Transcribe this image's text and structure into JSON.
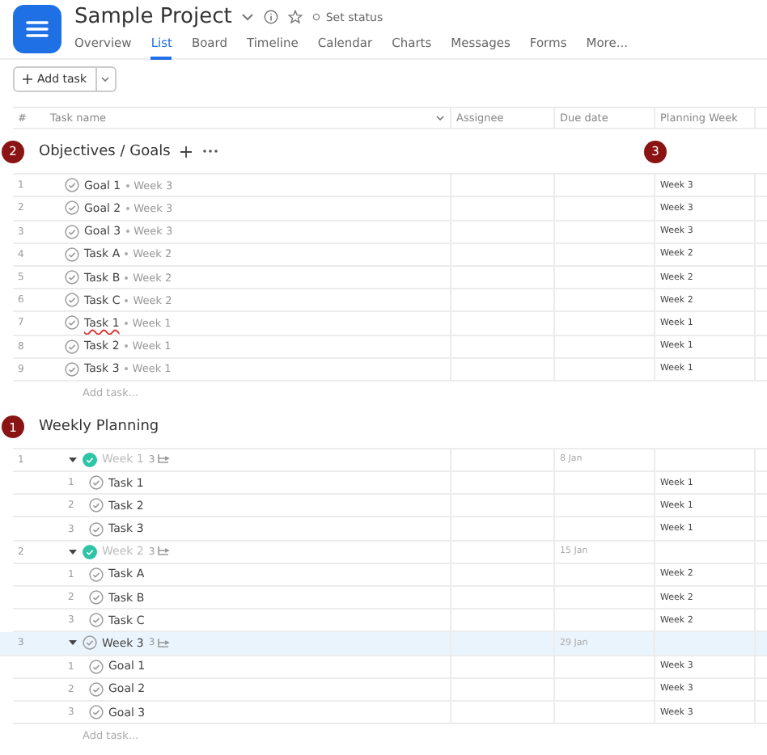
{
  "project": {
    "title": "Sample Project",
    "status": "Set status"
  },
  "tabs": [
    {
      "label": "Overview",
      "selected": false
    },
    {
      "label": "List",
      "selected": true
    },
    {
      "label": "Board",
      "selected": false
    },
    {
      "label": "Timeline",
      "selected": false
    },
    {
      "label": "Calendar",
      "selected": false
    },
    {
      "label": "Charts",
      "selected": false
    },
    {
      "label": "Messages",
      "selected": false
    },
    {
      "label": "Forms",
      "selected": false
    },
    {
      "label": "More...",
      "selected": false
    }
  ],
  "toolbar": {
    "add_task": "Add task"
  },
  "columns": [
    "#",
    "Task name",
    "Assignee",
    "Due date",
    "Planning Week"
  ],
  "sections": [
    {
      "title": "Objectives / Goals",
      "marker": "2",
      "column_marker": "3",
      "add_task": "Add task...",
      "tasks": [
        {
          "number": "1",
          "name": "Goal 1",
          "parent": "Week 3",
          "planning_week": "Week 3",
          "misspelled": false
        },
        {
          "number": "2",
          "name": "Goal 2",
          "parent": "Week 3",
          "planning_week": "Week 3",
          "misspelled": false
        },
        {
          "number": "3",
          "name": "Goal 3",
          "parent": "Week 3",
          "planning_week": "Week 3",
          "misspelled": false
        },
        {
          "number": "4",
          "name": "Task A",
          "parent": "Week 2",
          "planning_week": "Week 2",
          "misspelled": false
        },
        {
          "number": "5",
          "name": "Task B",
          "parent": "Week 2",
          "planning_week": "Week 2",
          "misspelled": false
        },
        {
          "number": "6",
          "name": "Task C",
          "parent": "Week 2",
          "planning_week": "Week 2",
          "misspelled": false
        },
        {
          "number": "7",
          "name": "Task 1",
          "parent": "Week 1",
          "planning_week": "Week 1",
          "misspelled": true
        },
        {
          "number": "8",
          "name": "Task 2",
          "parent": "Week 1",
          "planning_week": "Week 1",
          "misspelled": false
        },
        {
          "number": "9",
          "name": "Task 3",
          "parent": "Week 1",
          "planning_week": "Week 1",
          "misspelled": false
        }
      ]
    },
    {
      "title": "Weekly Planning",
      "marker": "1",
      "add_task": "Add task...",
      "tasks": [
        {
          "number": "1",
          "name": "Week 1",
          "completed": true,
          "expanded": true,
          "selected": false,
          "subtask_count": "3",
          "due_date": "8 Jan",
          "children": [
            {
              "number": "1",
              "name": "Task 1",
              "planning_week": "Week 1"
            },
            {
              "number": "2",
              "name": "Task 2",
              "planning_week": "Week 1"
            },
            {
              "number": "3",
              "name": "Task 3",
              "planning_week": "Week 1"
            }
          ]
        },
        {
          "number": "2",
          "name": "Week 2",
          "completed": true,
          "expanded": true,
          "selected": false,
          "subtask_count": "3",
          "due_date": "15 Jan",
          "children": [
            {
              "number": "1",
              "name": "Task A",
              "planning_week": "Week 2"
            },
            {
              "number": "2",
              "name": "Task B",
              "planning_week": "Week 2"
            },
            {
              "number": "3",
              "name": "Task C",
              "planning_week": "Week 2"
            }
          ]
        },
        {
          "number": "3",
          "name": "Week 3",
          "completed": false,
          "expanded": true,
          "selected": true,
          "subtask_count": "3",
          "due_date": "29 Jan",
          "children": [
            {
              "number": "1",
              "name": "Goal 1",
              "planning_week": "Week 3"
            },
            {
              "number": "2",
              "name": "Goal 2",
              "planning_week": "Week 3"
            },
            {
              "number": "3",
              "name": "Goal 3",
              "planning_week": "Week 3"
            }
          ]
        }
      ]
    }
  ]
}
